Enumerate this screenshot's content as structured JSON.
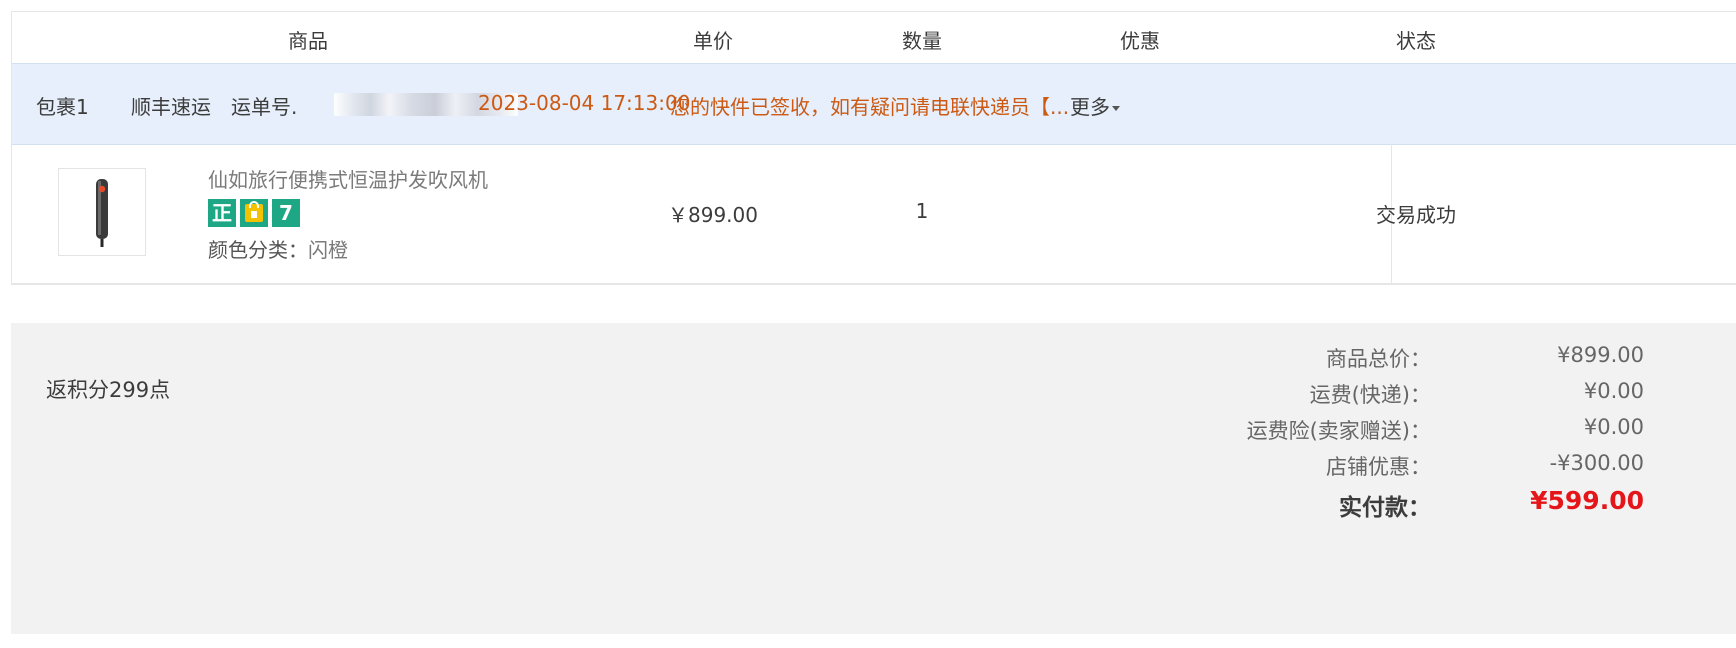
{
  "table": {
    "headers": {
      "product": "商品",
      "unit_price": "单价",
      "quantity": "数量",
      "discount": "优惠",
      "status": "状态"
    },
    "package": {
      "name": "包裹1",
      "carrier": "顺丰速运",
      "tracking_label": "运单号.",
      "timestamp": "2023-08-04 17:13:00",
      "message": "您的快件已签收，如有疑问请电联快递员【...",
      "more_label": "更多"
    },
    "item": {
      "title": "仙如旅行便携式恒温护发吹风机",
      "badges": [
        {
          "icon": "genuine-badge-icon",
          "text": "正"
        },
        {
          "icon": "shopping-bag-badge-icon",
          "text": ""
        },
        {
          "icon": "seven-day-return-badge-icon",
          "text": "7"
        }
      ],
      "attr_label": "颜色分类：",
      "attr_value": "闪橙",
      "unit_price": "￥899.00",
      "quantity": "1",
      "status": "交易成功"
    }
  },
  "summary": {
    "points": "返积分299点",
    "rows": [
      {
        "label": "商品总价：",
        "value": "¥899.00"
      },
      {
        "label": "运费(快递)：",
        "value": "¥0.00"
      },
      {
        "label": "运费险(卖家赠送)：",
        "value": "¥0.00"
      },
      {
        "label": "店铺优惠：",
        "value": "-¥300.00"
      }
    ],
    "total_label": "实付款：",
    "total_value": "¥599.00"
  },
  "colors": {
    "package_bg": "#e6effb",
    "accent_orange": "#cc5a14",
    "total_red": "#e4161a",
    "badge_green": "#1ea784",
    "summary_bg": "#f2f2f2"
  }
}
